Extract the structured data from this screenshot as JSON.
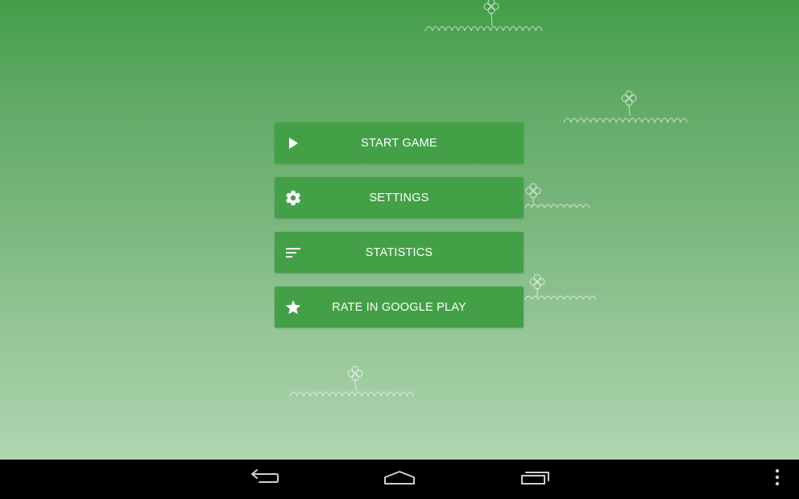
{
  "menu": {
    "items": [
      {
        "label": "START GAME",
        "icon": "play-icon"
      },
      {
        "label": "SETTINGS",
        "icon": "gear-icon"
      },
      {
        "label": "STATISTICS",
        "icon": "sort-lines-icon"
      },
      {
        "label": "RATE IN GOOGLE PLAY",
        "icon": "star-icon"
      }
    ]
  },
  "navbar": {
    "buttons": [
      {
        "icon": "back-icon"
      },
      {
        "icon": "home-icon"
      },
      {
        "icon": "recent-apps-icon"
      },
      {
        "icon": "overflow-menu-icon"
      }
    ]
  },
  "colors": {
    "button": "#43a047",
    "background_top": "#439d48",
    "background_bottom": "#afd6b0",
    "navbar": "#000000"
  }
}
